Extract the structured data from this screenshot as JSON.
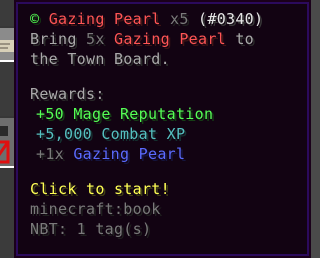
{
  "tooltip": {
    "title": {
      "icon": "©",
      "name": "Gazing Pearl",
      "quantity": "x5",
      "id": "(#0340)"
    },
    "description": {
      "prefix": "Bring",
      "amount": "5x",
      "item": "Gazing Pearl",
      "suffix_1": "to",
      "line2": "the Town Board."
    },
    "rewards_label": "Rewards:",
    "rewards": [
      {
        "text": "+50 Mage Reputation"
      },
      {
        "text": "+5,000 Combat XP"
      },
      {
        "prefix": "+1x",
        "item": "Gazing Pearl"
      }
    ],
    "action": "Click to start!",
    "item_id": "minecraft:book",
    "nbt": "NBT: 1 tag(s)"
  },
  "colors": {
    "green": "#55ff55",
    "red": "#ff5555",
    "aqua": "#55c0c0",
    "blue": "#5b6bff",
    "yellow": "#ffff55",
    "gray": "#aaaaaa",
    "tooltip_border": "#2b0a5c"
  },
  "icons": [
    "copyright-icon",
    "barrier-icon",
    "paper-icon"
  ]
}
